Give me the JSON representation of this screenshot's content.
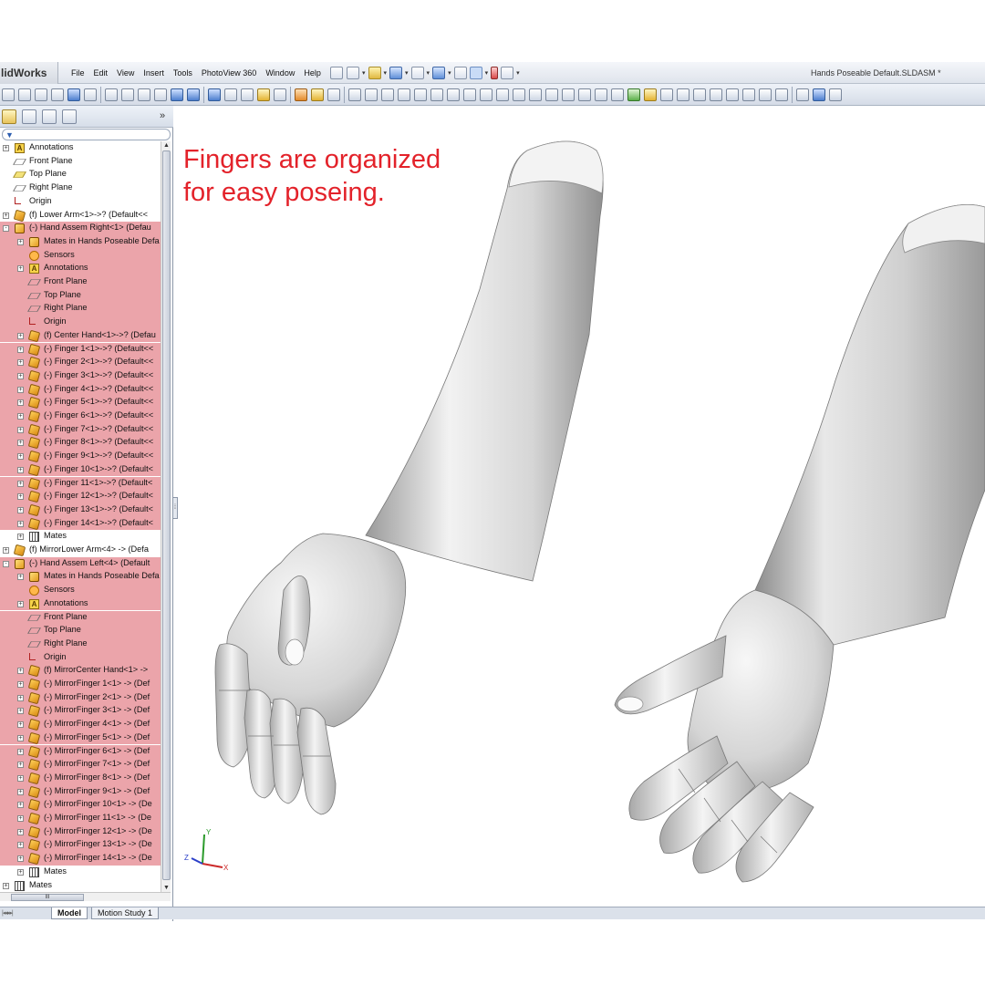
{
  "app": {
    "brand": "lidWorks",
    "document_title": "Hands Poseable Default.SLDASM *"
  },
  "menus": [
    "File",
    "Edit",
    "View",
    "Insert",
    "Tools",
    "PhotoView 360",
    "Window",
    "Help"
  ],
  "annotation": {
    "line1": "Fingers are organized",
    "line2": "for easy poseing."
  },
  "tree": [
    {
      "label": "Annotations",
      "indent": 0,
      "icon": "annotations-icon",
      "exp": "+",
      "hl": false
    },
    {
      "label": "Front Plane",
      "indent": 0,
      "icon": "plane-icon",
      "exp": "",
      "hl": false
    },
    {
      "label": "Top Plane",
      "indent": 0,
      "icon": "plane-selected-icon",
      "exp": "",
      "hl": false
    },
    {
      "label": "Right Plane",
      "indent": 0,
      "icon": "plane-icon",
      "exp": "",
      "hl": false
    },
    {
      "label": "Origin",
      "indent": 0,
      "icon": "origin-icon",
      "exp": "",
      "hl": false
    },
    {
      "label": "(f) Lower Arm<1>->? (Default<<",
      "indent": 0,
      "icon": "part-icon",
      "exp": "+",
      "hl": false
    },
    {
      "label": "(-) Hand Assem Right<1> (Defau",
      "indent": 0,
      "icon": "assembly-icon",
      "exp": "-",
      "hl": true
    },
    {
      "label": "Mates in Hands Poseable Defa",
      "indent": 1,
      "icon": "assembly-icon",
      "exp": "+",
      "hl": true
    },
    {
      "label": "Sensors",
      "indent": 1,
      "icon": "sensor-icon",
      "exp": "",
      "hl": true
    },
    {
      "label": "Annotations",
      "indent": 1,
      "icon": "annotations-icon",
      "exp": "+",
      "hl": true
    },
    {
      "label": "Front Plane",
      "indent": 1,
      "icon": "plane-icon",
      "exp": "",
      "hl": true
    },
    {
      "label": "Top Plane",
      "indent": 1,
      "icon": "plane-icon",
      "exp": "",
      "hl": true
    },
    {
      "label": "Right Plane",
      "indent": 1,
      "icon": "plane-icon",
      "exp": "",
      "hl": true
    },
    {
      "label": "Origin",
      "indent": 1,
      "icon": "origin-icon",
      "exp": "",
      "hl": true
    },
    {
      "label": "(f) Center Hand<1>->? (Defau",
      "indent": 1,
      "icon": "part-icon",
      "exp": "+",
      "hl": true
    },
    {
      "label": "(-) Finger 1<1>->? (Default<<",
      "indent": 1,
      "icon": "part-icon",
      "exp": "+",
      "hl": true
    },
    {
      "label": "(-) Finger 2<1>->? (Default<<",
      "indent": 1,
      "icon": "part-icon",
      "exp": "+",
      "hl": true
    },
    {
      "label": "(-) Finger 3<1>->? (Default<<",
      "indent": 1,
      "icon": "part-icon",
      "exp": "+",
      "hl": true
    },
    {
      "label": "(-) Finger 4<1>->? (Default<<",
      "indent": 1,
      "icon": "part-icon",
      "exp": "+",
      "hl": true
    },
    {
      "label": "(-) Finger 5<1>->? (Default<<",
      "indent": 1,
      "icon": "part-icon",
      "exp": "+",
      "hl": true
    },
    {
      "label": "(-) Finger 6<1>->? (Default<<",
      "indent": 1,
      "icon": "part-icon",
      "exp": "+",
      "hl": true
    },
    {
      "label": "(-) Finger 7<1>->? (Default<<",
      "indent": 1,
      "icon": "part-icon",
      "exp": "+",
      "hl": true
    },
    {
      "label": "(-) Finger 8<1>->? (Default<<",
      "indent": 1,
      "icon": "part-icon",
      "exp": "+",
      "hl": true
    },
    {
      "label": "(-) Finger 9<1>->? (Default<<",
      "indent": 1,
      "icon": "part-icon",
      "exp": "+",
      "hl": true
    },
    {
      "label": "(-) Finger 10<1>->? (Default<",
      "indent": 1,
      "icon": "part-icon",
      "exp": "+",
      "hl": true
    },
    {
      "label": "(-) Finger 11<1>->? (Default<",
      "indent": 1,
      "icon": "part-icon",
      "exp": "+",
      "hl": true
    },
    {
      "label": "(-) Finger 12<1>->? (Default<",
      "indent": 1,
      "icon": "part-icon",
      "exp": "+",
      "hl": true
    },
    {
      "label": "(-) Finger 13<1>->? (Default<",
      "indent": 1,
      "icon": "part-icon",
      "exp": "+",
      "hl": true
    },
    {
      "label": "(-) Finger 14<1>->? (Default<",
      "indent": 1,
      "icon": "part-icon",
      "exp": "+",
      "hl": true
    },
    {
      "label": "Mates",
      "indent": 1,
      "icon": "mates-icon",
      "exp": "+",
      "hl": false
    },
    {
      "label": "(f) MirrorLower Arm<4> -> (Defa",
      "indent": 0,
      "icon": "part-icon",
      "exp": "+",
      "hl": false
    },
    {
      "label": "(-) Hand Assem Left<4> (Default",
      "indent": 0,
      "icon": "assembly-icon",
      "exp": "-",
      "hl": true
    },
    {
      "label": "Mates in Hands Poseable Defa",
      "indent": 1,
      "icon": "assembly-icon",
      "exp": "+",
      "hl": true
    },
    {
      "label": "Sensors",
      "indent": 1,
      "icon": "sensor-icon",
      "exp": "",
      "hl": true
    },
    {
      "label": "Annotations",
      "indent": 1,
      "icon": "annotations-icon",
      "exp": "+",
      "hl": true
    },
    {
      "label": "Front Plane",
      "indent": 1,
      "icon": "plane-icon",
      "exp": "",
      "hl": true
    },
    {
      "label": "Top Plane",
      "indent": 1,
      "icon": "plane-icon",
      "exp": "",
      "hl": true
    },
    {
      "label": "Right Plane",
      "indent": 1,
      "icon": "plane-icon",
      "exp": "",
      "hl": true
    },
    {
      "label": "Origin",
      "indent": 1,
      "icon": "origin-icon",
      "exp": "",
      "hl": true
    },
    {
      "label": "(f) MirrorCenter Hand<1> ->",
      "indent": 1,
      "icon": "part-icon",
      "exp": "+",
      "hl": true
    },
    {
      "label": "(-) MirrorFinger 1<1> -> (Def",
      "indent": 1,
      "icon": "part-icon",
      "exp": "+",
      "hl": true
    },
    {
      "label": "(-) MirrorFinger 2<1> -> (Def",
      "indent": 1,
      "icon": "part-icon",
      "exp": "+",
      "hl": true
    },
    {
      "label": "(-) MirrorFinger 3<1> -> (Def",
      "indent": 1,
      "icon": "part-icon",
      "exp": "+",
      "hl": true
    },
    {
      "label": "(-) MirrorFinger 4<1> -> (Def",
      "indent": 1,
      "icon": "part-icon",
      "exp": "+",
      "hl": true
    },
    {
      "label": "(-) MirrorFinger 5<1> -> (Def",
      "indent": 1,
      "icon": "part-icon",
      "exp": "+",
      "hl": true
    },
    {
      "label": "(-) MirrorFinger 6<1> -> (Def",
      "indent": 1,
      "icon": "part-icon",
      "exp": "+",
      "hl": true
    },
    {
      "label": "(-) MirrorFinger 7<1> -> (Def",
      "indent": 1,
      "icon": "part-icon",
      "exp": "+",
      "hl": true
    },
    {
      "label": "(-) MirrorFinger 8<1> -> (Def",
      "indent": 1,
      "icon": "part-icon",
      "exp": "+",
      "hl": true
    },
    {
      "label": "(-) MirrorFinger 9<1> -> (Def",
      "indent": 1,
      "icon": "part-icon",
      "exp": "+",
      "hl": true
    },
    {
      "label": "(-) MirrorFinger 10<1> -> (De",
      "indent": 1,
      "icon": "part-icon",
      "exp": "+",
      "hl": true
    },
    {
      "label": "(-) MirrorFinger 11<1> -> (De",
      "indent": 1,
      "icon": "part-icon",
      "exp": "+",
      "hl": true
    },
    {
      "label": "(-) MirrorFinger 12<1> -> (De",
      "indent": 1,
      "icon": "part-icon",
      "exp": "+",
      "hl": true
    },
    {
      "label": "(-) MirrorFinger 13<1> -> (De",
      "indent": 1,
      "icon": "part-icon",
      "exp": "+",
      "hl": true
    },
    {
      "label": "(-) MirrorFinger 14<1> -> (De",
      "indent": 1,
      "icon": "part-icon",
      "exp": "+",
      "hl": true
    },
    {
      "label": "Mates",
      "indent": 1,
      "icon": "mates-icon",
      "exp": "+",
      "hl": false
    },
    {
      "label": "Mates",
      "indent": 0,
      "icon": "mates-icon",
      "exp": "+",
      "hl": false
    }
  ],
  "bottom_tabs": {
    "model": "Model",
    "motion_study": "Motion Study 1"
  },
  "triad": {
    "x": "X",
    "y": "Y",
    "z": "Z"
  },
  "colors": {
    "highlight": "#eba4aa",
    "annotation": "#e3222a"
  }
}
